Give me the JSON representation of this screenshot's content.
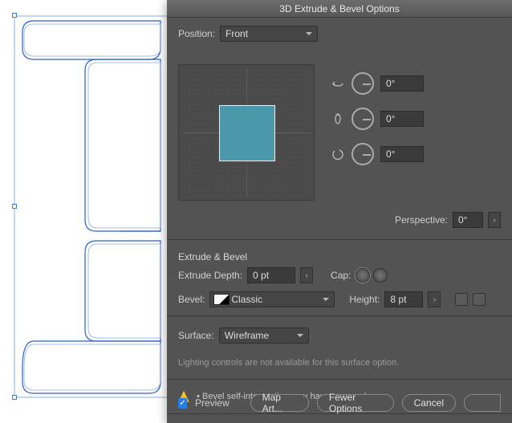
{
  "dialog": {
    "title": "3D Extrude & Bevel Options",
    "position": {
      "label": "Position:",
      "value": "Front"
    },
    "rotation": {
      "x": "0°",
      "y": "0°",
      "z": "0°"
    },
    "perspective": {
      "label": "Perspective:",
      "value": "0°"
    },
    "extrude_section": "Extrude & Bevel",
    "extrude_depth": {
      "label": "Extrude Depth:",
      "value": "0 pt"
    },
    "cap_label": "Cap:",
    "bevel": {
      "label": "Bevel:",
      "value": "Classic"
    },
    "height": {
      "label": "Height:",
      "value": "8 pt"
    },
    "surface": {
      "label": "Surface:",
      "value": "Wireframe"
    },
    "lighting_note": "Lighting controls are not available for this surface option.",
    "warning": "Bevel self-intersection may have occurred.",
    "preview_label": "Preview",
    "buttons": {
      "map_art": "Map Art...",
      "fewer_options": "Fewer Options",
      "cancel": "Cancel"
    }
  },
  "colors": {
    "swatch": "#4b98ab",
    "panel": "#535353"
  }
}
